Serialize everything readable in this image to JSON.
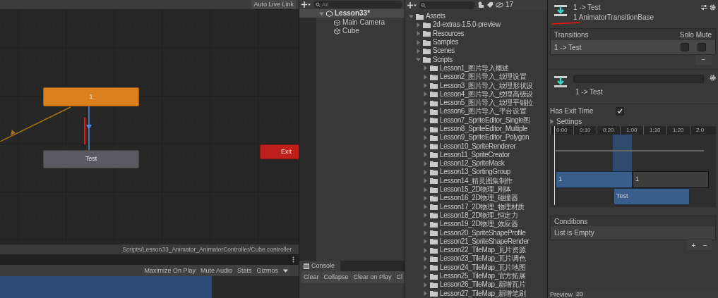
{
  "animator": {
    "auto_live_link": "Auto Live Link",
    "states": [
      {
        "label": "1",
        "kind": "default"
      },
      {
        "label": "Test",
        "kind": "normal"
      },
      {
        "label": "Exit",
        "kind": "exit"
      }
    ],
    "path": "Scripts/Lesson33_Animator_AnimatorController/Cube.controller"
  },
  "game_toolbar": {
    "buttons": [
      "Maximize On Play",
      "Mute Audio",
      "Stats",
      "Gizmos"
    ]
  },
  "hierarchy": {
    "search_placeholder": "All",
    "scene": "Lesson33*",
    "items": [
      "Main Camera",
      "Cube"
    ]
  },
  "console": {
    "tab": "Console",
    "buttons": [
      "Clear",
      "Collapse",
      "Clear on Play",
      "Cl"
    ]
  },
  "project": {
    "hidden_count": "17",
    "tree": [
      {
        "label": "Assets",
        "expanded": true,
        "children": [
          {
            "label": "2d-extras-1.5.0-preview",
            "expanded": false
          },
          {
            "label": "Resources",
            "expanded": false
          },
          {
            "label": "Samples",
            "expanded": false
          },
          {
            "label": "Scenes",
            "expanded": false
          },
          {
            "label": "Scripts",
            "expanded": true,
            "children": [
              {
                "label": "Lesson1_图片导入概述",
                "expanded": false
              },
              {
                "label": "Lesson2_图片导入_纹理设置",
                "expanded": false
              },
              {
                "label": "Lesson3_图片导入_纹理形状设",
                "expanded": false
              },
              {
                "label": "Lesson4_图片导入_纹理高级设",
                "expanded": false
              },
              {
                "label": "Lesson5_图片导入_纹理平铺拉",
                "expanded": false
              },
              {
                "label": "Lesson6_图片导入_平台设置",
                "expanded": false
              },
              {
                "label": "Lesson7_SpriteEditor_Single图",
                "expanded": false
              },
              {
                "label": "Lesson8_SpriteEditor_Multiple",
                "expanded": false
              },
              {
                "label": "Lesson9_SpriteEditor_Polygon",
                "expanded": false
              },
              {
                "label": "Lesson10_SpriteRenderer",
                "expanded": false
              },
              {
                "label": "Lesson11_SpriteCreator",
                "expanded": false
              },
              {
                "label": "Lesson12_SpriteMask",
                "expanded": false
              },
              {
                "label": "Lesson13_SortingGroup",
                "expanded": false
              },
              {
                "label": "Lesson14_精灵图集制作",
                "expanded": false
              },
              {
                "label": "Lesson15_2D物理_刚体",
                "expanded": false
              },
              {
                "label": "Lesson16_2D物理_碰撞器",
                "expanded": false
              },
              {
                "label": "Lesson17_2D物理_物理材质",
                "expanded": false
              },
              {
                "label": "Lesson18_2D物理_恒定力",
                "expanded": false
              },
              {
                "label": "Lesson19_2D物理_效应器",
                "expanded": false
              },
              {
                "label": "Lesson20_SpriteShapeProfile",
                "expanded": false
              },
              {
                "label": "Lesson21_SpriteShapeRender",
                "expanded": false
              },
              {
                "label": "Lesson22_TileMap_瓦片资源",
                "expanded": false
              },
              {
                "label": "Lesson23_TileMap_瓦片调色",
                "expanded": false
              },
              {
                "label": "Lesson24_TileMap_瓦片地图",
                "expanded": false
              },
              {
                "label": "Lesson25_TileMap_官方拓展",
                "expanded": false
              },
              {
                "label": "Lesson26_TileMap_新增瓦片",
                "expanded": false
              },
              {
                "label": "Lesson27_TileMap_新增笔刷",
                "expanded": false
              }
            ]
          }
        ]
      }
    ]
  },
  "inspector": {
    "title": "1 -> Test",
    "subtitle": "1 AnimatorTransitionBase",
    "transitions": {
      "columns": [
        "Transitions",
        "Solo",
        "Mute"
      ],
      "rows": [
        {
          "name": "1 -> Test",
          "solo": false,
          "mute": false,
          "selected": true
        }
      ],
      "remove": "−"
    },
    "transition_name": "1 -> Test",
    "has_exit_time": {
      "label": "Has Exit Time",
      "checked": true
    },
    "settings": {
      "label": "Settings",
      "expanded": false
    },
    "timeline": {
      "ticks": [
        "0:00",
        "0:10",
        "0:20",
        "1:00",
        "1:10",
        "1:20",
        "2:0"
      ],
      "clips": [
        {
          "label": "1",
          "kind": "source"
        },
        {
          "label": "1",
          "kind": "tail"
        },
        {
          "label": "Test",
          "kind": "destination"
        }
      ]
    },
    "conditions": {
      "title": "Conditions",
      "empty": "List is Empty",
      "add": "+",
      "remove": "−"
    },
    "preview": {
      "label": "Preview",
      "mode": "2D"
    }
  }
}
